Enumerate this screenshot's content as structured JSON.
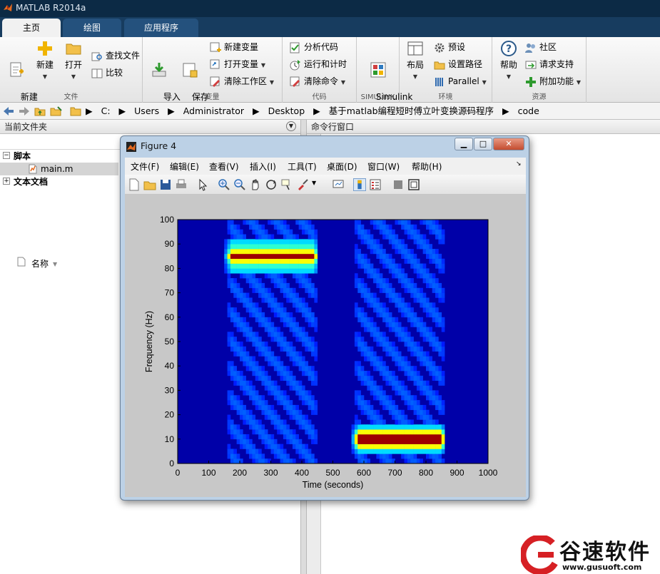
{
  "window": {
    "title": "MATLAB R2014a"
  },
  "tabs": [
    {
      "label": "主页",
      "active": true
    },
    {
      "label": "绘图",
      "active": false
    },
    {
      "label": "应用程序",
      "active": false
    }
  ],
  "ribbon": {
    "file": {
      "group_label": "文件",
      "new_script": "新建\n脚本",
      "new": "新建",
      "open": "打开",
      "find_files": "查找文件",
      "compare": "比较"
    },
    "variable": {
      "group_label": "变量",
      "import_data": "导入\n数据",
      "save_workspace": "保存\n工作区",
      "new_variable": "新建变量",
      "open_variable": "打开变量",
      "clear_workspace": "清除工作区"
    },
    "code": {
      "group_label": "代码",
      "analyze_code": "分析代码",
      "run_and_time": "运行和计时",
      "clear_commands": "清除命令"
    },
    "simulink": {
      "group_label": "SIMULINK",
      "library": "Simulink\n库"
    },
    "environment": {
      "group_label": "环境",
      "layout": "布局",
      "preferences": "预设",
      "set_path": "设置路径",
      "parallel": "Parallel"
    },
    "resources": {
      "group_label": "资源",
      "help": "帮助",
      "community": "社区",
      "request_support": "请求支持",
      "add_ons": "附加功能"
    }
  },
  "address": {
    "segments": [
      "C:",
      "Users",
      "Administrator",
      "Desktop",
      "基于matlab编程短时傅立叶变换源码程序",
      "code"
    ]
  },
  "current_folder": {
    "title": "当前文件夹",
    "col_name": "名称",
    "groups": [
      {
        "label": "脚本",
        "expanded": true,
        "items": [
          "main.m"
        ]
      },
      {
        "label": "文本文档",
        "expanded": false,
        "items": []
      }
    ]
  },
  "command_window": {
    "title": "命令行窗口"
  },
  "figure": {
    "title": "Figure 4",
    "menu": [
      "文件(F)",
      "编辑(E)",
      "查看(V)",
      "插入(I)",
      "工具(T)",
      "桌面(D)",
      "窗口(W)",
      "帮助(H)"
    ]
  },
  "chart_data": {
    "type": "heatmap",
    "title": "",
    "xlabel": "Time (seconds)",
    "ylabel": "Frequency (Hz)",
    "xlim": [
      0,
      1000
    ],
    "ylim": [
      0,
      100
    ],
    "xticks": [
      0,
      100,
      200,
      300,
      400,
      500,
      600,
      700,
      800,
      900,
      1000
    ],
    "yticks": [
      0,
      10,
      20,
      30,
      40,
      50,
      60,
      70,
      80,
      90,
      100
    ],
    "colormap": "jet",
    "background_color": "#0000a8",
    "components": [
      {
        "t_start": 170,
        "t_end": 430,
        "frequency": 85
      },
      {
        "t_start": 580,
        "t_end": 840,
        "frequency": 10
      }
    ]
  },
  "watermark": {
    "text": "谷速软件",
    "url": "www.gusuoft.com"
  }
}
